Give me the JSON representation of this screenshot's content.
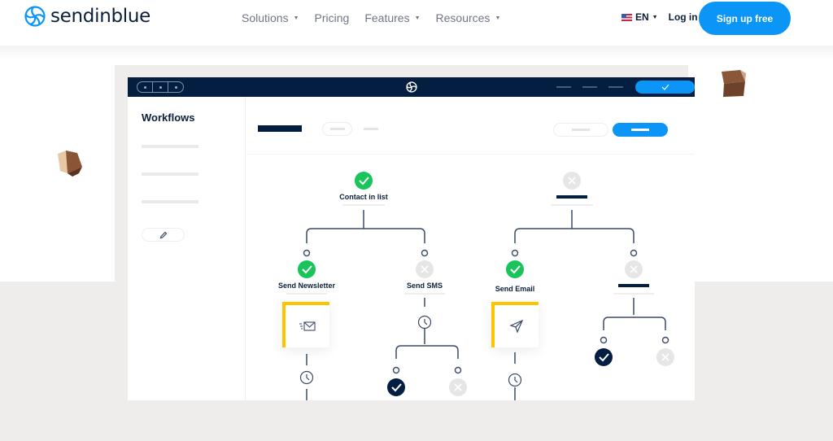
{
  "brand": {
    "name": "sendinblue",
    "accent_color": "#0b96f7",
    "navy_color": "#041e42"
  },
  "nav": {
    "items": [
      {
        "label": "Solutions",
        "has_dropdown": true
      },
      {
        "label": "Pricing",
        "has_dropdown": false
      },
      {
        "label": "Features",
        "has_dropdown": true
      },
      {
        "label": "Resources",
        "has_dropdown": true
      }
    ],
    "language": "EN",
    "login": "Log in",
    "signup": "Sign up free"
  },
  "mockup": {
    "sidebar_title": "Workflows",
    "icons": {
      "bar_logo": "sendinblue-logo-icon",
      "confirm": "checkmark-icon",
      "edit": "pencil-icon"
    },
    "workflow": {
      "root_left": {
        "label": "Contact in list",
        "status": "success"
      },
      "root_right": {
        "label": "",
        "status": "disabled"
      },
      "branches": [
        {
          "label": "Send Newsletter",
          "status": "success",
          "card_icon": "email-icon",
          "delay_icon": "clock-icon"
        },
        {
          "label": "Send SMS",
          "status": "disabled",
          "delay_icon": "clock-icon",
          "outcomes": [
            "checked",
            "disabled"
          ]
        },
        {
          "label": "Send Email",
          "status": "success",
          "card_icon": "paper-plane-icon",
          "delay_icon": "clock-icon"
        },
        {
          "label": "",
          "status": "disabled",
          "outcomes": [
            "checked",
            "disabled"
          ]
        }
      ]
    },
    "status_colors": {
      "success": "#19c45a",
      "disabled": "#e6e6e6",
      "checked": "#041e42",
      "card_accent": "#ffc400"
    }
  }
}
